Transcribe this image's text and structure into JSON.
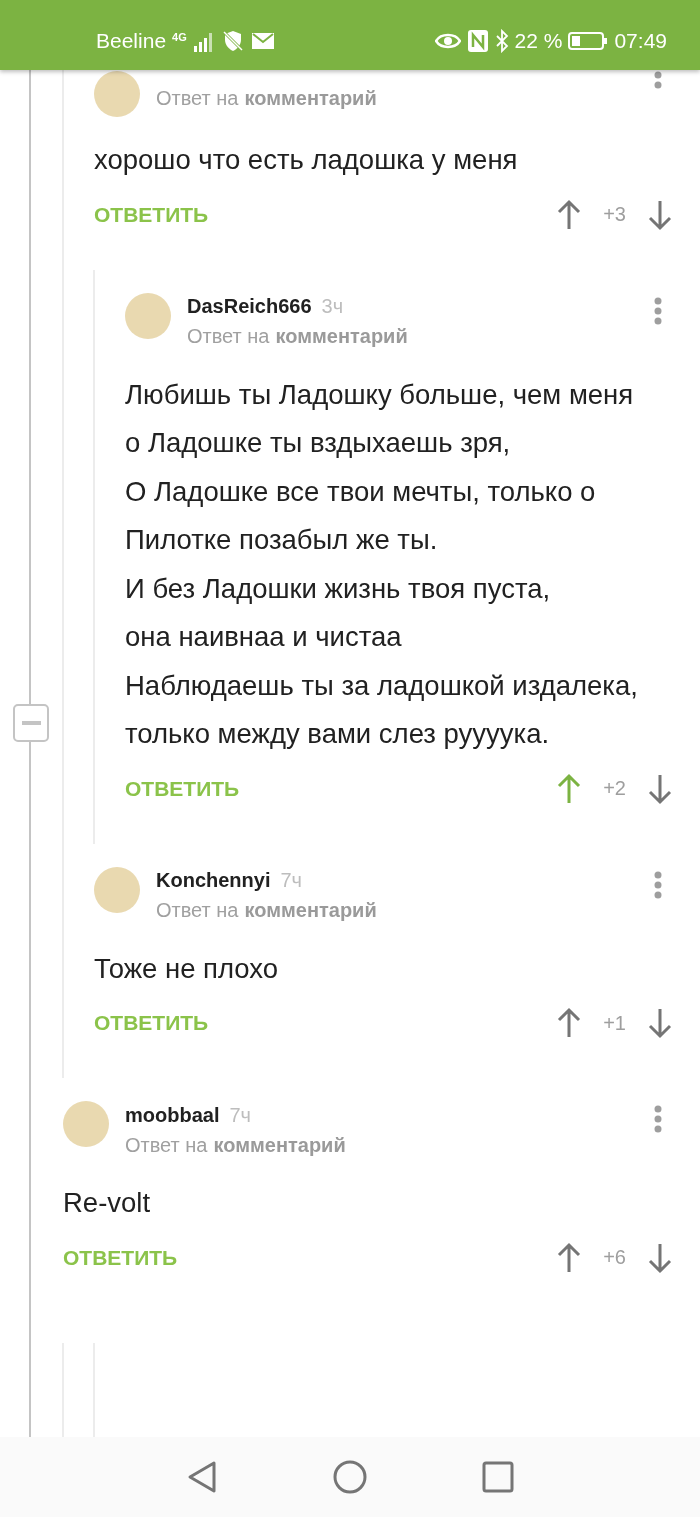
{
  "status_bar": {
    "carrier": "Beeline",
    "network_type": "4G",
    "battery_percent": "22 %",
    "time": "07:49"
  },
  "thread": {
    "collapsed": false,
    "items": [
      {
        "kind": "continuation",
        "children": [
          {
            "kind": "comment",
            "reply_prefix": "Ответ на",
            "reply_link": "комментарий",
            "paragraphs": [
              "хорошо что есть ладошка у меня"
            ],
            "reply_action": "ОТВЕТИТЬ",
            "score": "+3",
            "upvoted": false,
            "children": [
              {
                "kind": "comment",
                "author": "DasReich666",
                "time": "3ч",
                "reply_prefix": "Ответ на",
                "reply_link": "комментарий",
                "paragraphs": [
                  "Любишь ты Ладошку больше, чем меня",
                  "о Ладошке ты вздыхаешь зря,",
                  "О Ладошке все твои мечты, только о Пилотке позабыл же ты.",
                  "И без Ладошки жизнь твоя пуста,",
                  "она наивнаа и чистаа",
                  "Наблюдаешь ты за ладошкой издалека, только между вами слез руууука."
                ],
                "reply_action": "ОТВЕТИТЬ",
                "score": "+2",
                "upvoted": true
              }
            ]
          },
          {
            "kind": "comment",
            "author": "Konchennyi",
            "time": "7ч",
            "reply_prefix": "Ответ на",
            "reply_link": "комментарий",
            "paragraphs": [
              "Тоже не плохо"
            ],
            "reply_action": "ОТВЕТИТЬ",
            "score": "+1",
            "upvoted": false
          }
        ]
      },
      {
        "kind": "comment",
        "author": "moobbaal",
        "time": "7ч",
        "reply_prefix": "Ответ на",
        "reply_link": "комментарий",
        "paragraphs": [
          "Re-volt"
        ],
        "reply_action": "ОТВЕТИТЬ",
        "score": "+6",
        "upvoted": false,
        "children": [
          {
            "kind": "continuation"
          }
        ]
      }
    ]
  }
}
